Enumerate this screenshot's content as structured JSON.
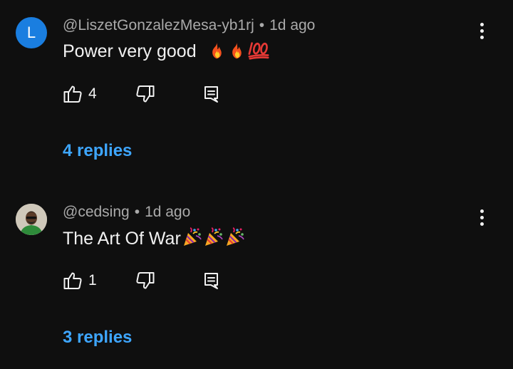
{
  "comments": [
    {
      "avatar_letter": "L",
      "avatar_color": "#1a7ee0",
      "author": "@LiszetGonzalezMesa-yb1rj",
      "separator": "•",
      "time": "1d ago",
      "text": "Power very good",
      "emojis": [
        "fire-emoji",
        "fire-emoji",
        "hundred-points-emoji"
      ],
      "like_count": "4",
      "replies_label": "4 replies"
    },
    {
      "avatar_type": "photo",
      "author": "@cedsing",
      "separator": "•",
      "time": "1d ago",
      "text": "The Art Of War",
      "emojis": [
        "party-popper-emoji",
        "party-popper-emoji",
        "party-popper-emoji"
      ],
      "like_count": "1",
      "replies_label": "3 replies"
    }
  ],
  "icons": {
    "like": "thumbs-up-icon",
    "dislike": "thumbs-down-icon",
    "reply": "comment-icon",
    "more": "more-vertical-icon"
  },
  "colors": {
    "background": "#0f0f0f",
    "text": "#f1f1f1",
    "meta": "#aaaaaa",
    "link": "#3ea6ff"
  }
}
